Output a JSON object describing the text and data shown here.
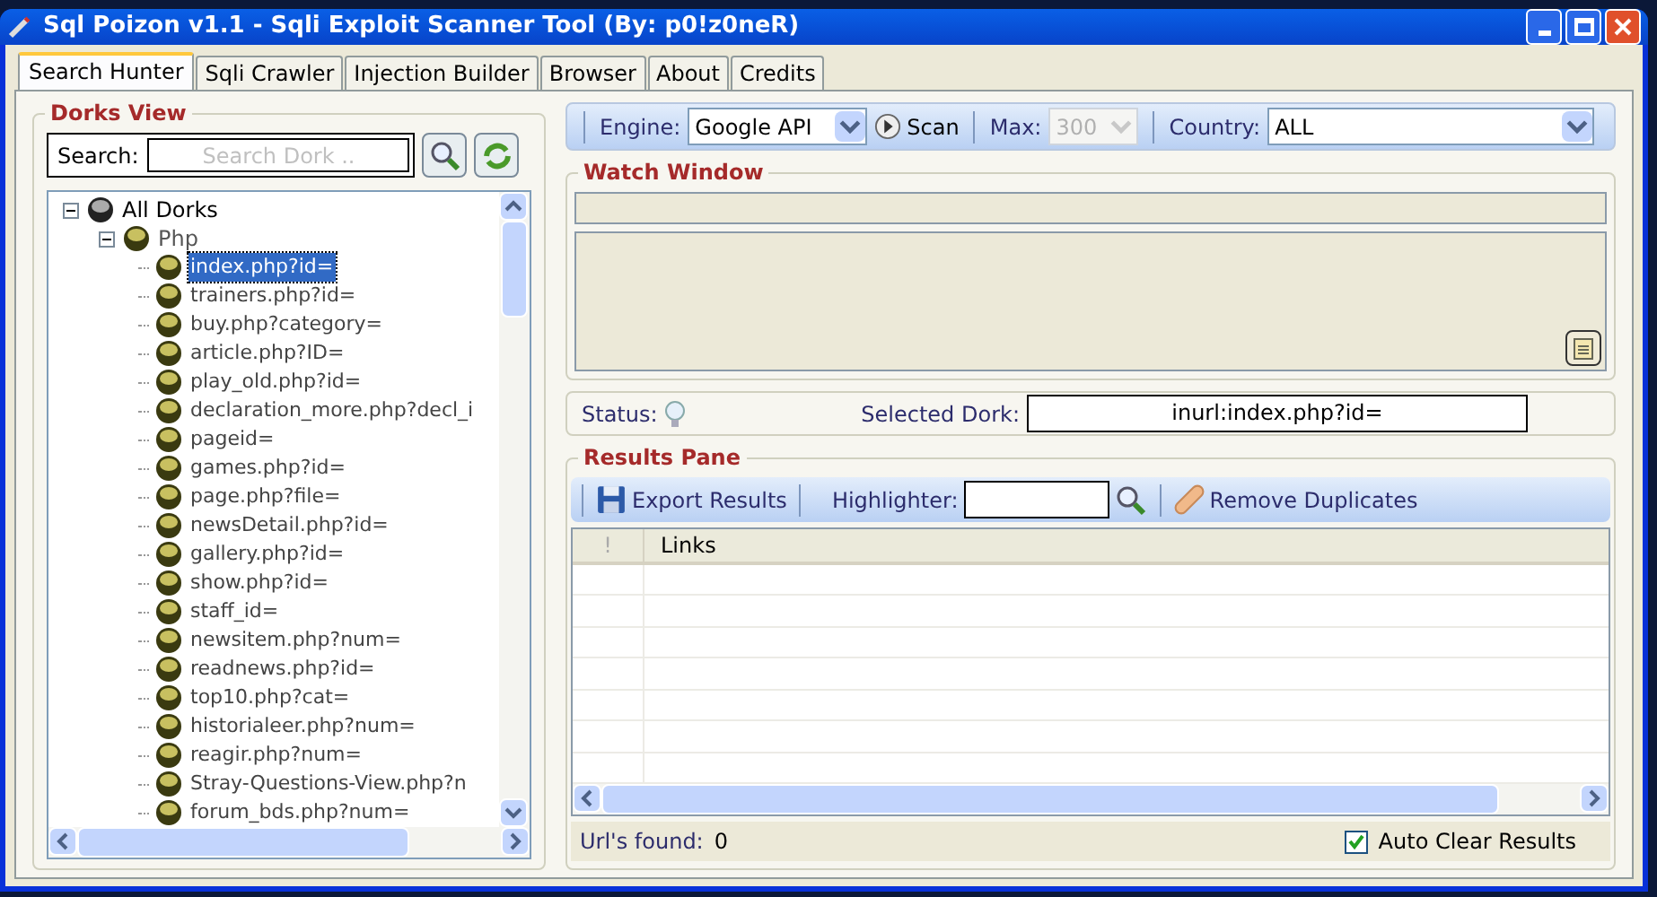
{
  "window": {
    "title": "Sql Poizon v1.1 - Sqli Exploit Scanner Tool (By: p0!z0neR)"
  },
  "tabs": [
    {
      "label": "Search Hunter",
      "selected": true
    },
    {
      "label": "Sqli Crawler",
      "selected": false
    },
    {
      "label": "Injection Builder",
      "selected": false
    },
    {
      "label": "Browser",
      "selected": false
    },
    {
      "label": "About",
      "selected": false
    },
    {
      "label": "Credits",
      "selected": false
    }
  ],
  "dorks_view": {
    "title": "Dorks View",
    "search_label": "Search:",
    "search": {
      "placeholder": "Search Dork .."
    },
    "tree": [
      {
        "label": "All Dorks",
        "expanded": true,
        "children": [
          {
            "label": "Php",
            "expanded": true,
            "children": [
              {
                "label": "index.php?id=",
                "selected": true
              },
              {
                "label": "trainers.php?id=",
                "selected": false
              },
              {
                "label": "buy.php?category=",
                "selected": false
              },
              {
                "label": "article.php?ID=",
                "selected": false
              },
              {
                "label": "play_old.php?id=",
                "selected": false
              },
              {
                "label": "declaration_more.php?decl_i",
                "selected": false
              },
              {
                "label": "pageid=",
                "selected": false
              },
              {
                "label": "games.php?id=",
                "selected": false
              },
              {
                "label": "page.php?file=",
                "selected": false
              },
              {
                "label": "newsDetail.php?id=",
                "selected": false
              },
              {
                "label": "gallery.php?id=",
                "selected": false
              },
              {
                "label": "show.php?id=",
                "selected": false
              },
              {
                "label": "staff_id=",
                "selected": false
              },
              {
                "label": "newsitem.php?num=",
                "selected": false
              },
              {
                "label": "readnews.php?id=",
                "selected": false
              },
              {
                "label": "top10.php?cat=",
                "selected": false
              },
              {
                "label": "historialeer.php?num=",
                "selected": false
              },
              {
                "label": "reagir.php?num=",
                "selected": false
              },
              {
                "label": "Stray-Questions-View.php?n",
                "selected": false
              },
              {
                "label": "forum_bds.php?num=",
                "selected": false
              }
            ]
          }
        ]
      }
    ]
  },
  "toolbar": {
    "engine_label": "Engine:",
    "engine": "Google API",
    "scan": "Scan",
    "max_label": "Max:",
    "max": {
      "value": "300",
      "disabled": true
    },
    "country_label": "Country:",
    "country": "ALL"
  },
  "watch_window": {
    "title": "Watch Window"
  },
  "status_row": {
    "status_label": "Status:",
    "selected_dork_label": "Selected Dork:",
    "selected_dork": "inurl:index.php?id="
  },
  "results_pane": {
    "title": "Results Pane",
    "export": "Export Results",
    "highlighter_label": "Highlighter:",
    "remove_duplicates": "Remove Duplicates",
    "columns": [
      "!",
      "Links"
    ],
    "found_label": "Url's found:",
    "found": "0",
    "auto_clear": {
      "label": "Auto Clear Results",
      "checked": true
    }
  }
}
